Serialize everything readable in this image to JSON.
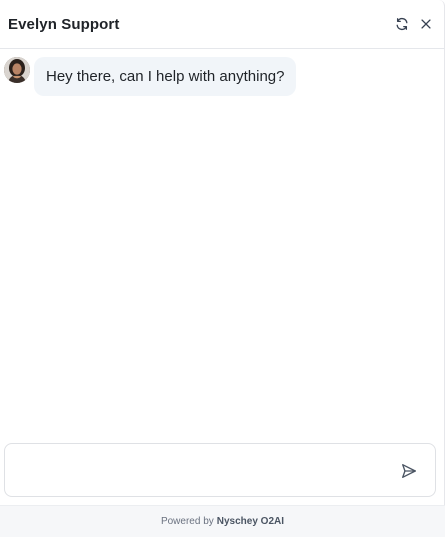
{
  "header": {
    "title": "Evelyn Support",
    "refresh_icon": "refresh-icon",
    "close_icon": "close-icon"
  },
  "messages": [
    {
      "sender": "agent",
      "avatar": "agent-avatar",
      "text": "Hey there, can I help with anything?"
    }
  ],
  "composer": {
    "value": "",
    "placeholder": "",
    "send_icon": "send-icon"
  },
  "footer": {
    "prefix": "Powered by",
    "brand": "Nyschey O2AI"
  },
  "colors": {
    "bubble_bg": "#f1f5f9",
    "footer_bg": "#f6f7f9",
    "text": "#1f2328"
  }
}
